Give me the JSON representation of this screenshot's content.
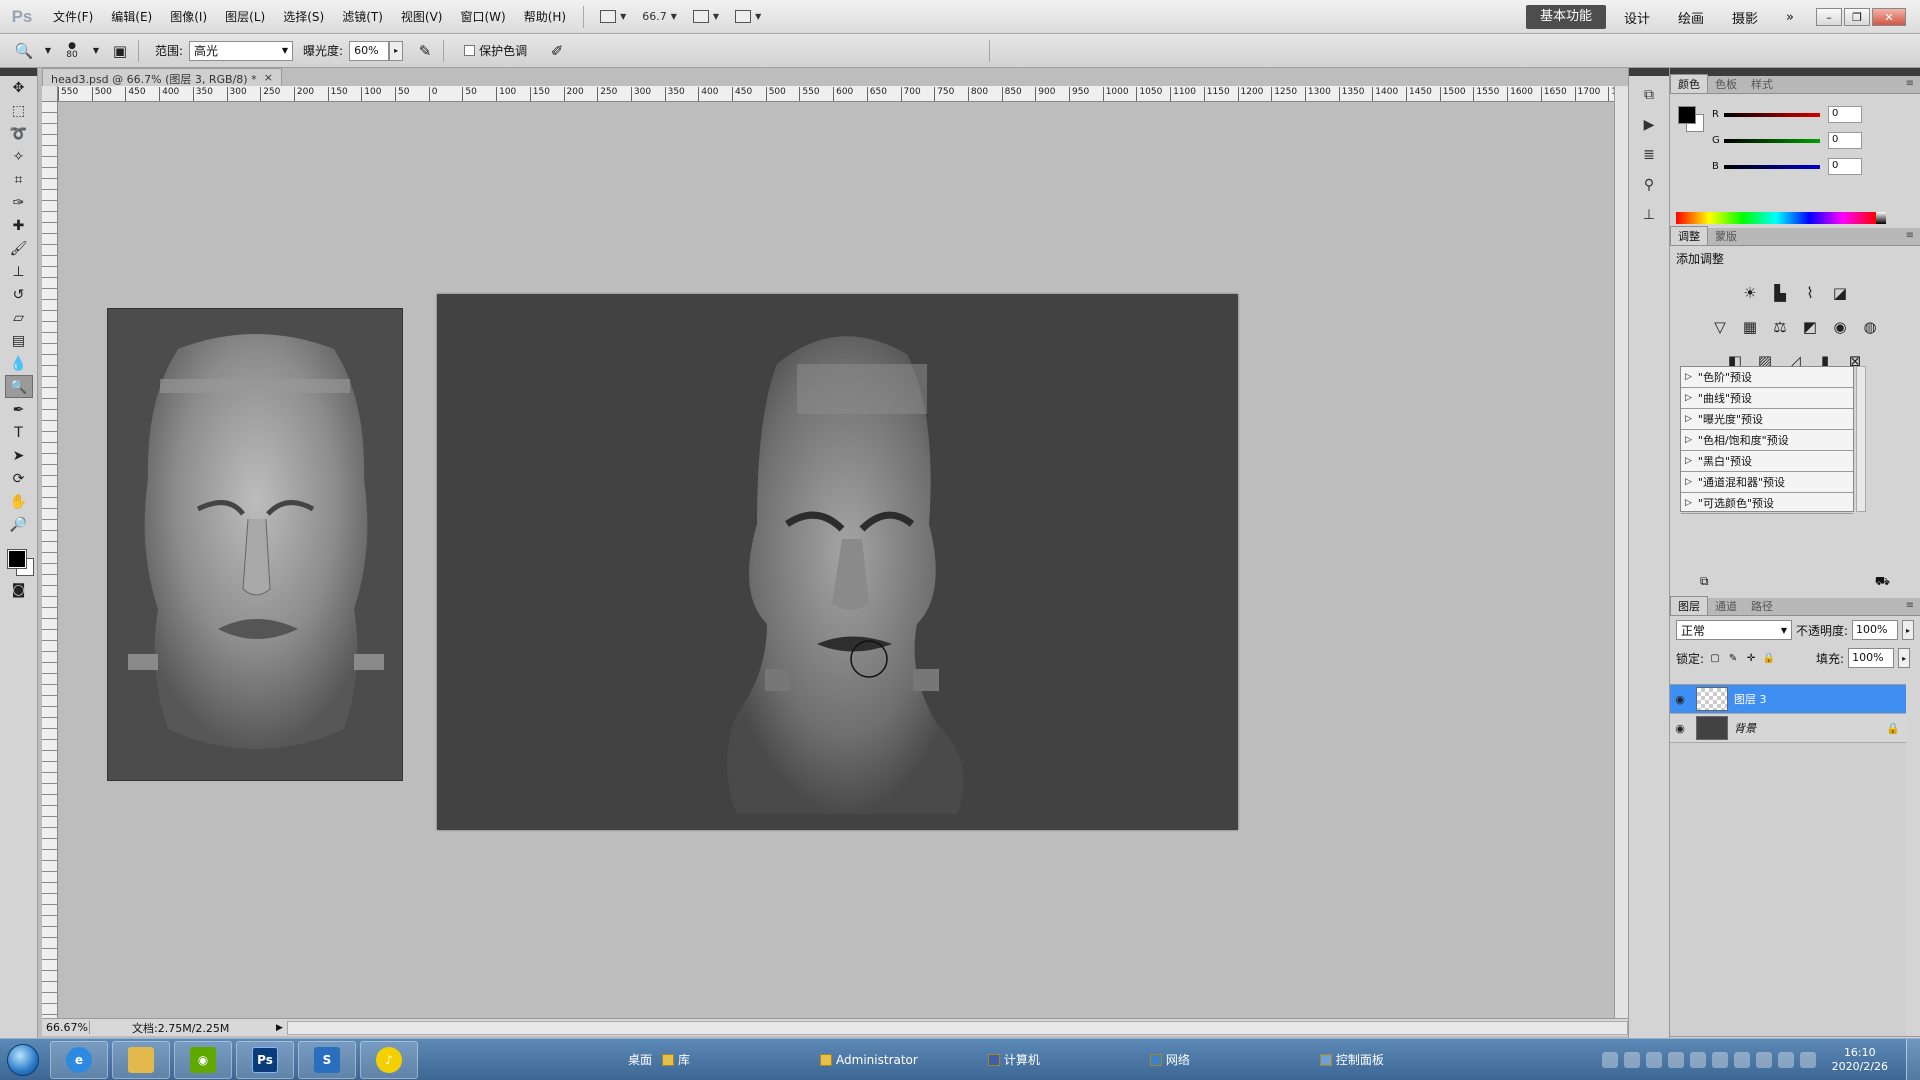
{
  "app": {
    "logo": "Ps",
    "menus": [
      "文件(F)",
      "编辑(E)",
      "图像(I)",
      "图层(L)",
      "选择(S)",
      "滤镜(T)",
      "视图(V)",
      "窗口(W)",
      "帮助(H)"
    ],
    "zoom_control": "66.7",
    "workspaces": [
      "基本功能",
      "设计",
      "绘画",
      "摄影"
    ],
    "more_workspaces": "»"
  },
  "options": {
    "brush_size": "80",
    "range_label": "范围:",
    "range_value": "高光",
    "exposure_label": "曝光度:",
    "exposure_value": "60%",
    "protect_tones_label": "保护色调"
  },
  "document": {
    "tab_title": "head3.psd @ 66.7% (图层 3, RGB/8) *",
    "tab_close": "×",
    "status_zoom": "66.67%",
    "status_doc": "文档:2.75M/2.25M",
    "ruler_ticks": [
      "550",
      "500",
      "450",
      "400",
      "350",
      "300",
      "250",
      "200",
      "150",
      "100",
      "50",
      "0",
      "50",
      "100",
      "150",
      "200",
      "250",
      "300",
      "350",
      "400",
      "450",
      "500",
      "550",
      "600",
      "650",
      "700",
      "750",
      "800",
      "850",
      "900",
      "950",
      "1000",
      "1050",
      "1100",
      "1150",
      "1200",
      "1250",
      "1300",
      "1350",
      "1400",
      "1450",
      "1500",
      "1550",
      "1600",
      "1650",
      "1700",
      "17"
    ]
  },
  "color_panel": {
    "tabs": [
      "颜色",
      "色板",
      "样式"
    ],
    "channels": [
      {
        "name": "R",
        "value": "0",
        "color": "#d40000"
      },
      {
        "name": "G",
        "value": "0",
        "color": "#00a000"
      },
      {
        "name": "B",
        "value": "0",
        "color": "#0000d0"
      }
    ]
  },
  "adjustments_panel": {
    "tabs": [
      "调整",
      "蒙版"
    ],
    "title": "添加调整",
    "presets": [
      "\"色阶\"预设",
      "\"曲线\"预设",
      "\"曝光度\"预设",
      "\"色相/饱和度\"预设",
      "\"黑白\"预设",
      "\"通道混和器\"预设",
      "\"可选颜色\"预设"
    ]
  },
  "layers_panel": {
    "tabs": [
      "图层",
      "通道",
      "路径"
    ],
    "blend_mode": "正常",
    "opacity_label": "不透明度:",
    "opacity_value": "100%",
    "lock_label": "锁定:",
    "fill_label": "填充:",
    "fill_value": "100%",
    "layers": [
      {
        "name": "图层 3",
        "selected": true
      },
      {
        "name": "背景",
        "selected": false
      }
    ]
  },
  "taskbar": {
    "links": [
      "桌面",
      "库",
      "Administrator",
      "计算机",
      "网络",
      "控制面板"
    ],
    "time": "16:10",
    "date": "2020/2/26",
    "apps": [
      {
        "name": "ie-browser",
        "color": "#2d8ae0"
      },
      {
        "name": "file-explorer",
        "color": "#e2b94a"
      },
      {
        "name": "nvidia",
        "color": "#5ea800"
      },
      {
        "name": "photoshop",
        "color": "#0b3b78"
      },
      {
        "name": "sai",
        "color": "#2a6fbf"
      },
      {
        "name": "qq-music",
        "color": "#f5d000"
      }
    ]
  }
}
